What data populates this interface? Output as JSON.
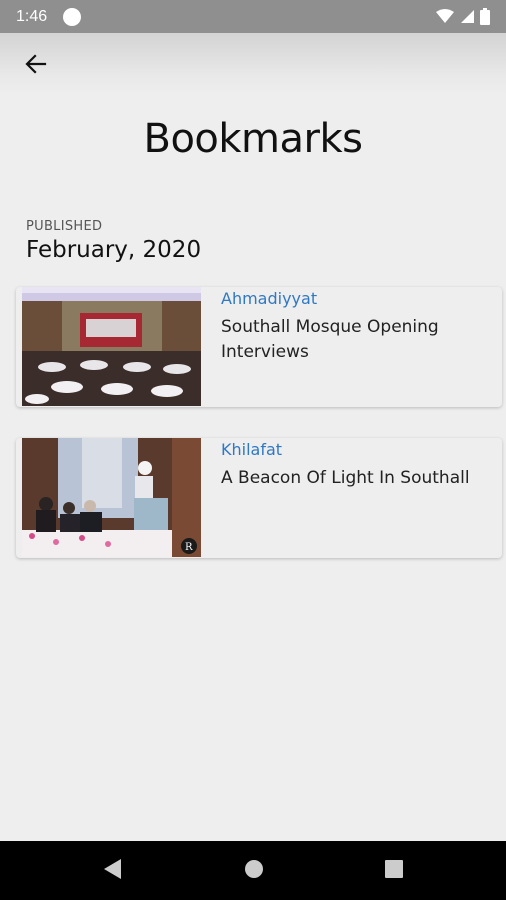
{
  "status_bar": {
    "time": "1:46"
  },
  "header": {
    "back_icon": "arrow-left-icon"
  },
  "page": {
    "title": "Bookmarks"
  },
  "section": {
    "label": "PUBLISHED",
    "date": "February, 2020"
  },
  "bookmarks": [
    {
      "category": "Ahmadiyyat",
      "title": "Southall Mosque Opening Interviews",
      "image": "mosque-hall-photo"
    },
    {
      "category": "Khilafat",
      "title": "A Beacon Of Light In Southall",
      "image": "speaker-at-podium-photo"
    }
  ],
  "colors": {
    "accent": "#2f78c4",
    "background": "#eeeeee",
    "status_bar": "#8f8f8f",
    "nav_bar": "#000000"
  }
}
